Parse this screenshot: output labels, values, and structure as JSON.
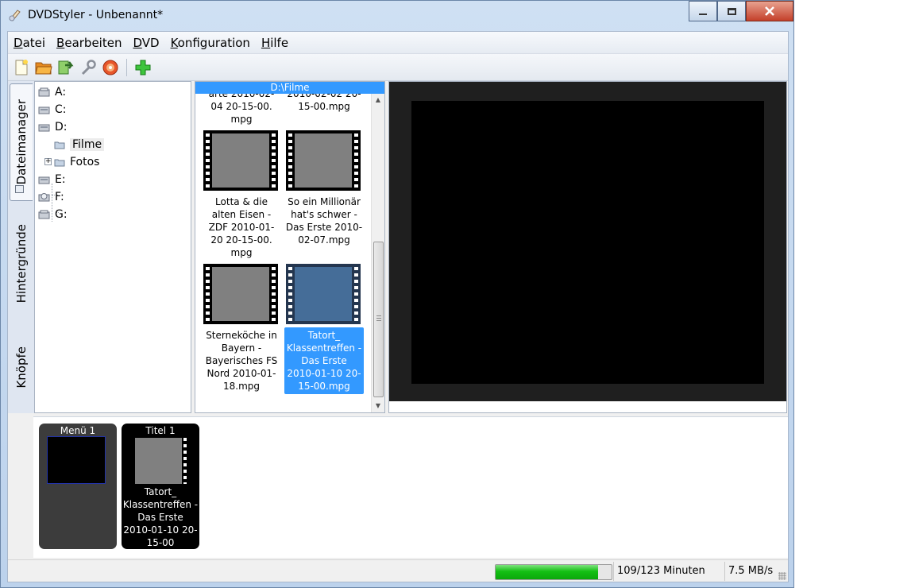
{
  "window": {
    "title": "DVDStyler - Unbenannt*"
  },
  "menubar": {
    "items": [
      {
        "label": "Datei"
      },
      {
        "label": "Bearbeiten"
      },
      {
        "label": "DVD"
      },
      {
        "label": "Konfiguration"
      },
      {
        "label": "Hilfe"
      }
    ]
  },
  "toolbar": {
    "buttons": [
      "new-file-icon",
      "open-folder-icon",
      "save-icon",
      "settings-wrench-icon",
      "burn-disc-icon",
      "add-icon"
    ]
  },
  "side_tabs": [
    {
      "label": "Dateimanager",
      "active": true
    },
    {
      "label": "Hintergründe",
      "active": false
    },
    {
      "label": "Knöpfe",
      "active": false
    }
  ],
  "dir_tree": {
    "drives": [
      "A:",
      "C:",
      "D:",
      "E:",
      "F:",
      "G:"
    ],
    "folders": [
      "Filme",
      "Fotos"
    ],
    "selected": "Filme"
  },
  "file_browser": {
    "path": "D:\\Filme",
    "partial_items": [
      "arte 2010-02-04 20-15-00.mpg",
      "2010-02-02 20-15-00.mpg"
    ],
    "partial_visible_labels": [
      "arte 2010-02-\n04 20-15-00.\nmpg",
      "2010-02-02 20-\n15-00.mpg"
    ],
    "items": [
      {
        "label": "Lotta & die alten Eisen - ZDF 2010-01-20 20-15-00.mpg",
        "lines": [
          "Lotta & die",
          "alten Eisen -",
          "ZDF 2010-01-",
          "20 20-15-00.",
          "mpg"
        ],
        "selected": false
      },
      {
        "label": "So ein Millionär hat's schwer - Das Erste 2010-02-07.mpg",
        "lines": [
          "So ein Millionär",
          "hat's schwer -",
          "Das Erste 2010-",
          "02-07.mpg"
        ],
        "selected": false
      },
      {
        "label": "Sterneköche in Bayern - Bayerisches FS Nord 2010-01-18.mpg",
        "lines": [
          "Sterneköche in",
          "Bayern -",
          "Bayerisches FS",
          "Nord 2010-01-",
          "18.mpg"
        ],
        "selected": false
      },
      {
        "label": "Tatort_ Klassentreffen - Das Erste 2010-01-10 20-15-00.mpg",
        "lines": [
          "Tatort_",
          "Klassentreffen -",
          "Das Erste",
          "2010-01-10 20-",
          "15-00.mpg"
        ],
        "selected": true
      }
    ]
  },
  "titleset": {
    "menu": {
      "caption": "Menü 1"
    },
    "title": {
      "caption": "Titel 1",
      "lines": [
        "Tatort_",
        "Klassentreffen -",
        "Das Erste",
        "2010-01-10 20-",
        "15-00"
      ]
    }
  },
  "status": {
    "progress_fraction": 0.886,
    "duration": "109/123 Minuten",
    "bitrate": "7.5 MB/s"
  },
  "colors": {
    "selection": "#3399ff",
    "progress": "#13c013"
  }
}
